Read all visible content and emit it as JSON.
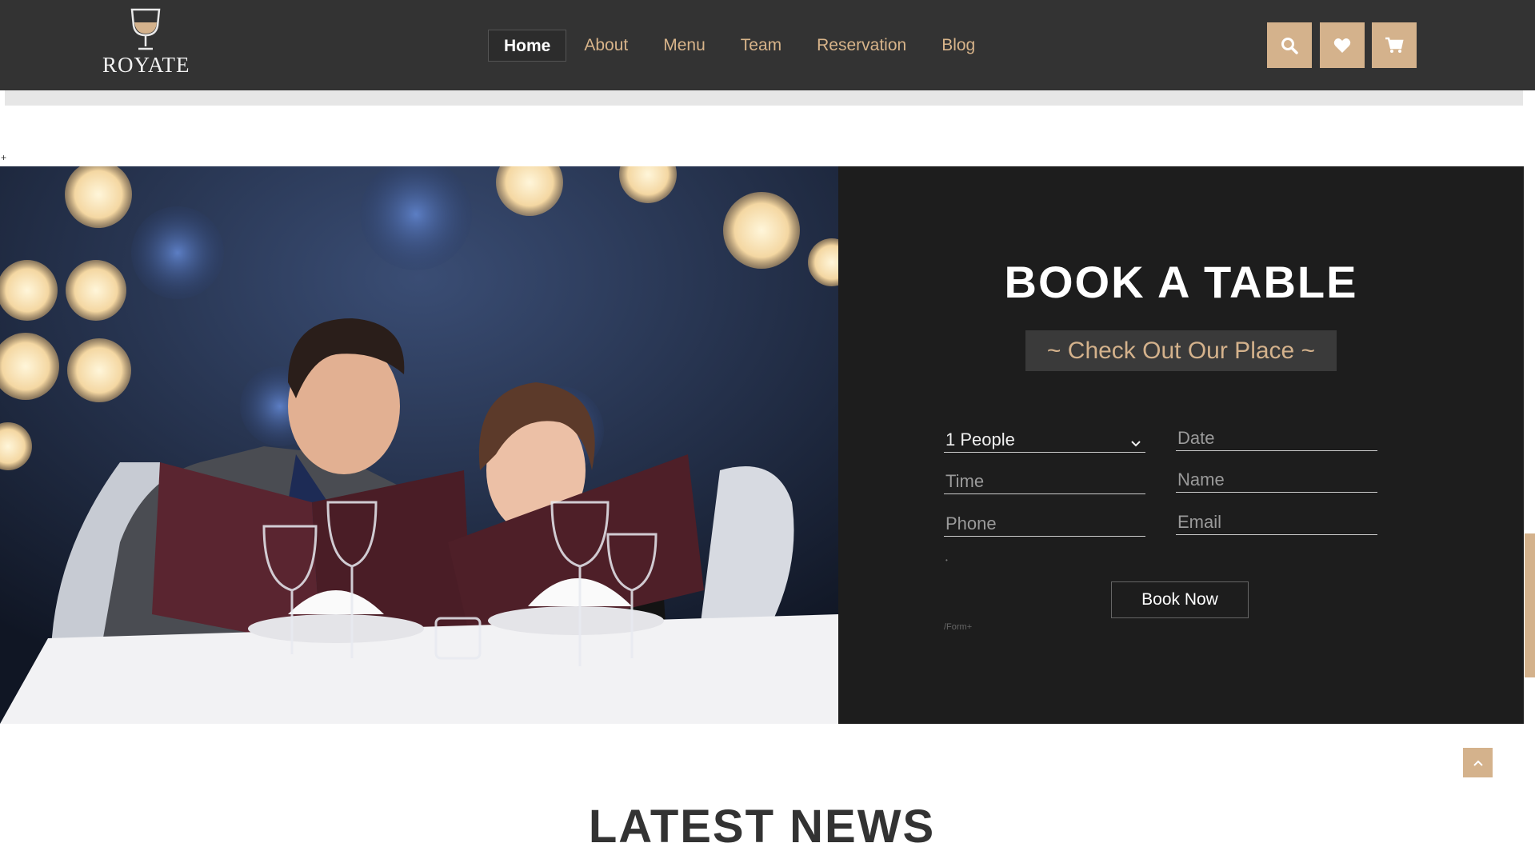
{
  "brand": {
    "name": "ROYATE",
    "logo_icon": "wine-glass-icon"
  },
  "nav": {
    "items": [
      {
        "label": "Home",
        "active": true
      },
      {
        "label": "About"
      },
      {
        "label": "Menu"
      },
      {
        "label": "Team"
      },
      {
        "label": "Reservation"
      },
      {
        "label": "Blog"
      }
    ],
    "buttons": [
      {
        "icon": "search-icon"
      },
      {
        "icon": "heart-icon"
      },
      {
        "icon": "cart-icon"
      }
    ]
  },
  "misc": {
    "plus_mark": "+",
    "dot_mark": "•"
  },
  "booking": {
    "title": "BOOK A TABLE",
    "subtitle": "~ Check Out Our Place ~",
    "people_select": "1 People",
    "fields": {
      "date": "Date",
      "time": "Time",
      "name": "Name",
      "phone": "Phone",
      "email": "Email"
    },
    "submit_label": "Book Now",
    "form_comment": "/Form+"
  },
  "news": {
    "title": "LATEST NEWS"
  },
  "colors": {
    "accent": "#d4b28c",
    "nav_bg": "#333333",
    "panel_bg": "#1d1d1d"
  }
}
